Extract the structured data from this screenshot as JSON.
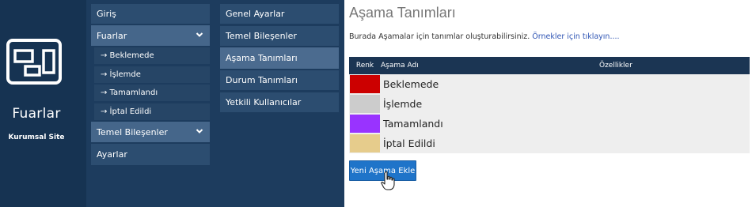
{
  "brand": {
    "title": "Fuarlar",
    "subtitle": "Kurumsal Site",
    "logo_icon": "layout-icon"
  },
  "menu_left": {
    "items": [
      {
        "label": "Giriş"
      },
      {
        "label": "Fuarlar",
        "expanded": true
      },
      {
        "label": "→ Beklemede"
      },
      {
        "label": "→ İşlemde"
      },
      {
        "label": "→ Tamamlandı"
      },
      {
        "label": "→ İptal Edildi"
      },
      {
        "label": "Temel Bileşenler",
        "expanded": true
      },
      {
        "label": "Ayarlar"
      }
    ]
  },
  "menu_right": {
    "items": [
      {
        "label": "Genel Ayarlar"
      },
      {
        "label": "Temel Bileşenler"
      },
      {
        "label": "Aşama Tanımları",
        "active": true
      },
      {
        "label": "Durum Tanımları"
      },
      {
        "label": "Yetkili Kullanıcılar"
      }
    ]
  },
  "main": {
    "title": "Aşama Tanımları",
    "description": "Burada Aşamalar için tanımlar oluşturabilirsiniz.",
    "example_link": "Örnekler için tıklayın....",
    "table": {
      "headers": [
        "Renk",
        "Aşama Adı",
        "Özellikler"
      ],
      "rows": [
        {
          "color": "#cc0000",
          "name": "Beklemede"
        },
        {
          "color": "#cccccc",
          "name": "İşlemde"
        },
        {
          "color": "#9933ff",
          "name": "Tamamlandı"
        },
        {
          "color": "#e6cc8c",
          "name": "İptal Edildi"
        }
      ]
    },
    "add_button": "Yeni Aşama Ekle"
  },
  "colors": {
    "brand_bg": "#163352",
    "menu_bg": "#1d3c5e",
    "menu_item": "#2c4d70",
    "accent": "#1f74c9",
    "table_header": "#1b3553"
  }
}
